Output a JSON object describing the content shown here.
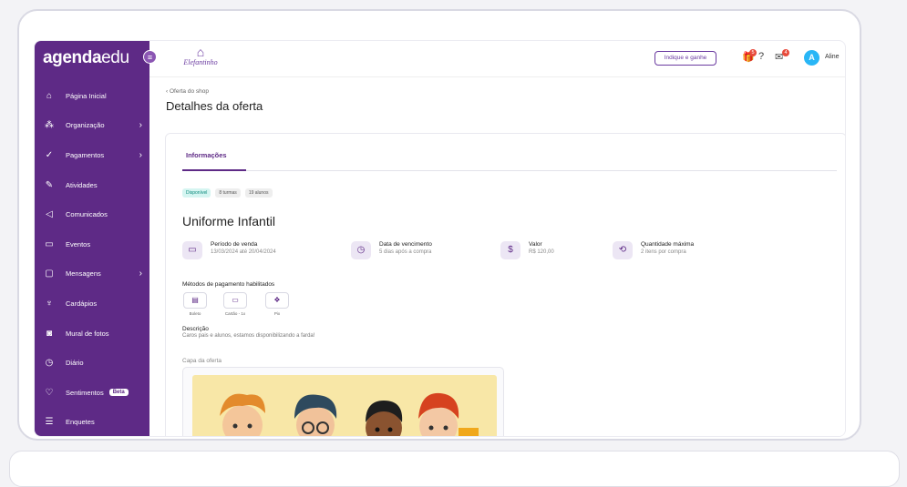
{
  "sidebar": {
    "logo_main": "agenda",
    "logo_sub": "edu",
    "items": [
      {
        "label": "Página Inicial",
        "icon": "home-icon",
        "glyph": "⌂"
      },
      {
        "label": "Organização",
        "icon": "org-icon",
        "glyph": "⁂",
        "chevron": "›"
      },
      {
        "label": "Pagamentos",
        "icon": "check-icon",
        "glyph": "✓",
        "chevron": "›"
      },
      {
        "label": "Atividades",
        "icon": "pencil-icon",
        "glyph": "✎"
      },
      {
        "label": "Comunicados",
        "icon": "megaphone-icon",
        "glyph": "◁"
      },
      {
        "label": "Eventos",
        "icon": "calendar-icon",
        "glyph": "▭"
      },
      {
        "label": "Mensagens",
        "icon": "chat-icon",
        "glyph": "▢",
        "chevron": "›"
      },
      {
        "label": "Cardápios",
        "icon": "food-icon",
        "glyph": "♆"
      },
      {
        "label": "Mural de fotos",
        "icon": "camera-icon",
        "glyph": "◙"
      },
      {
        "label": "Diário",
        "icon": "clock-icon",
        "glyph": "◷"
      },
      {
        "label": "Sentimentos",
        "icon": "heart-icon",
        "glyph": "♡",
        "badge": "Beta"
      },
      {
        "label": "Enquetes",
        "icon": "list-icon",
        "glyph": "☰"
      }
    ]
  },
  "topbar": {
    "school_name": "Elefantinho",
    "indique_label": "Indique e ganhe",
    "notif_1": "5",
    "notif_2": "4",
    "avatar_letter": "A",
    "user_name": "Aline"
  },
  "page": {
    "breadcrumb": "‹ Oferta do shop",
    "title": "Detalhes da oferta"
  },
  "offer": {
    "tab_label": "Informações",
    "badges": [
      "Disponível",
      "8 turmas",
      "19 alunos"
    ],
    "name": "Uniforme Infantil",
    "info": [
      {
        "label": "Período de venda",
        "value": "13/03/2024 até 20/04/2024"
      },
      {
        "label": "Data de vencimento",
        "value": "5 dias após a compra"
      },
      {
        "label": "Valor",
        "value": "R$ 120,00"
      },
      {
        "label": "Quantidade máxima",
        "value": "2 itens por compra"
      }
    ],
    "payment_title": "Métodos de pagamento habilitados",
    "payments": [
      {
        "label": "Boleto",
        "glyph": "▤"
      },
      {
        "label": "Cartão - 1x",
        "glyph": "▭"
      },
      {
        "label": "Pix",
        "glyph": "❖"
      }
    ],
    "desc_title": "Descrição",
    "desc_value": "Caros pais e alunos, estamos disponibilizando a farda!",
    "cover_title": "Capa da oferta"
  },
  "colors": {
    "brand": "#5e2a86",
    "accent": "#29b6f6",
    "alert": "#e84b3c"
  }
}
